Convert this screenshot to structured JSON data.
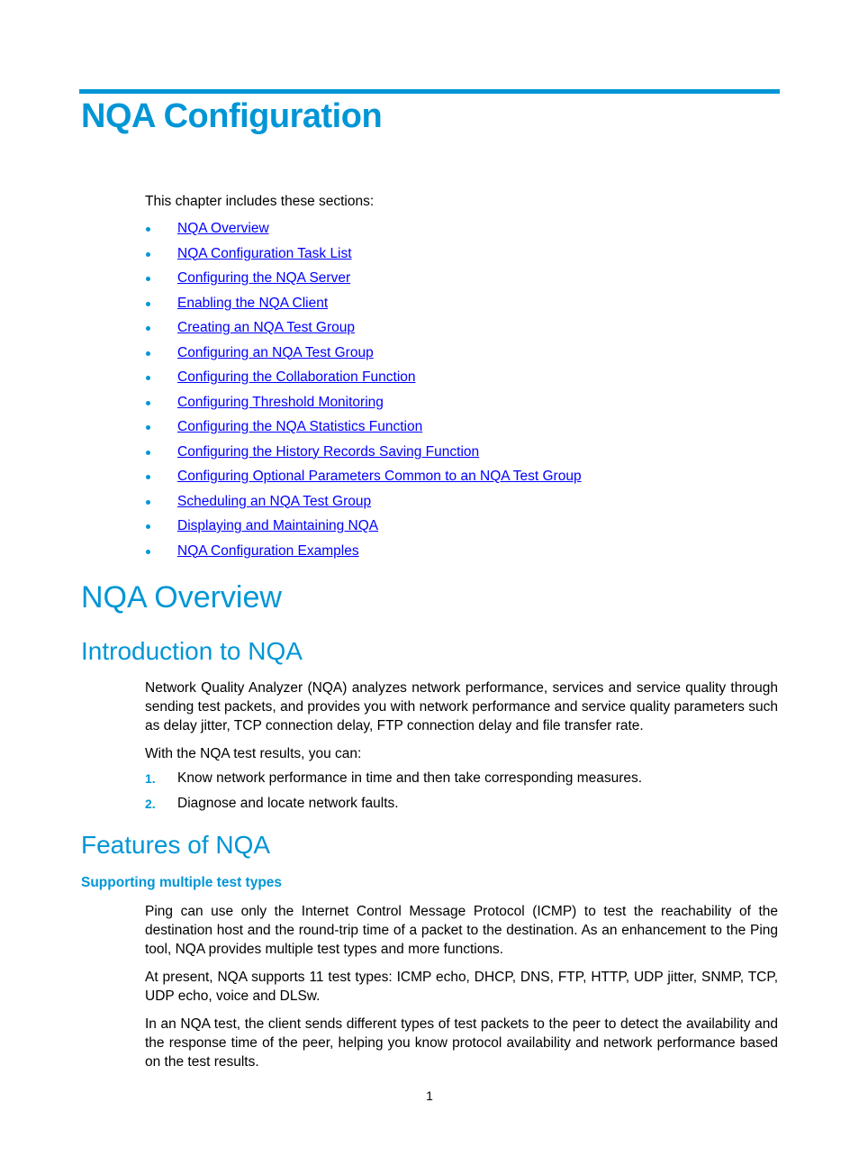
{
  "chapter_title": "NQA Configuration",
  "intro_text": "This chapter includes these sections:",
  "toc": [
    "NQA Overview",
    "NQA Configuration Task List",
    "Configuring the NQA Server",
    "Enabling the NQA Client",
    "Creating an NQA Test Group",
    "Configuring an NQA Test Group",
    "Configuring the Collaboration Function",
    "Configuring Threshold Monitoring",
    "Configuring the NQA Statistics Function",
    "Configuring the History Records Saving Function",
    "Configuring Optional Parameters Common to an NQA Test Group",
    "Scheduling an NQA Test Group",
    "Displaying and Maintaining NQA",
    "NQA Configuration Examples"
  ],
  "overview": {
    "title": "NQA Overview",
    "introduction": {
      "title": "Introduction to NQA",
      "p1": "Network Quality Analyzer (NQA) analyzes network performance, services and service quality through sending test packets, and provides you with network performance and service quality parameters such as delay jitter, TCP connection delay, FTP connection delay and file transfer rate.",
      "p2": "With the NQA test results, you can:",
      "steps": [
        {
          "num": "1.",
          "text": "Know network performance in time and then take corresponding measures."
        },
        {
          "num": "2.",
          "text": "Diagnose and locate network faults."
        }
      ]
    },
    "features": {
      "title": "Features of NQA",
      "subtitle": "Supporting multiple test types",
      "p1": "Ping can use only the Internet Control Message Protocol (ICMP) to test the reachability of the destination host and the round-trip time of a packet to the destination. As an enhancement to the Ping tool, NQA provides multiple test types and more functions.",
      "p2": "At present, NQA supports 11 test types: ICMP echo, DHCP, DNS, FTP, HTTP, UDP jitter, SNMP, TCP, UDP echo, voice and DLSw.",
      "p3": "In an NQA test, the client sends different types of test packets to the peer to detect the availability and the response time of the peer, helping you know protocol availability and network performance based on the test results."
    }
  },
  "page_number": "1"
}
